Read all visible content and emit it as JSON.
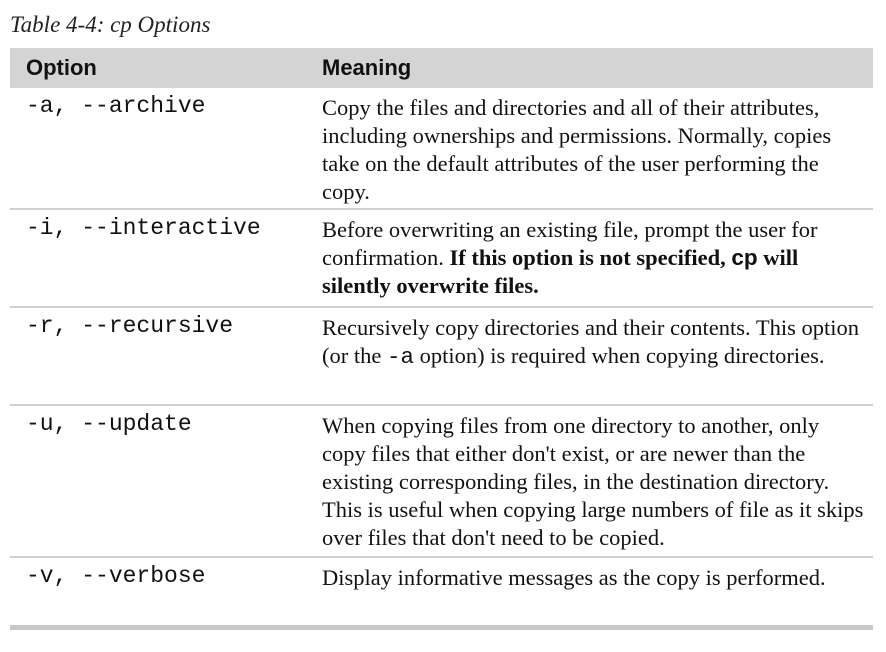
{
  "caption": "Table 4-4: cp Options",
  "header": {
    "option": "Option",
    "meaning": "Meaning"
  },
  "rows": [
    {
      "option": "-a, --archive",
      "meaning": "Copy the files and directories and all of their attributes, including ownerships and permissions. Normally, copies take on the default attributes of the user performing the copy."
    },
    {
      "option": "-i, --interactive",
      "meaning_plain": "Before overwriting an existing file, prompt the user for confirmation. ",
      "meaning_bold_1": "If this option is not specified, ",
      "meaning_code": "cp",
      "meaning_bold_2": " will silently overwrite files."
    },
    {
      "option": "-r, --recursive",
      "meaning_1": "Recursively copy directories and their contents. This option (or the ",
      "meaning_code": "-a",
      "meaning_2": " option) is required when copying directories."
    },
    {
      "option": "-u, --update",
      "meaning": "When copying files from one directory to another, only copy files that either don't exist, or are newer than the existing corresponding files, in the destination directory. This is useful when copying large numbers of file as it skips over files that don't need to be copied."
    },
    {
      "option": "-v, --verbose",
      "meaning": "Display informative messages as the copy is performed."
    }
  ]
}
